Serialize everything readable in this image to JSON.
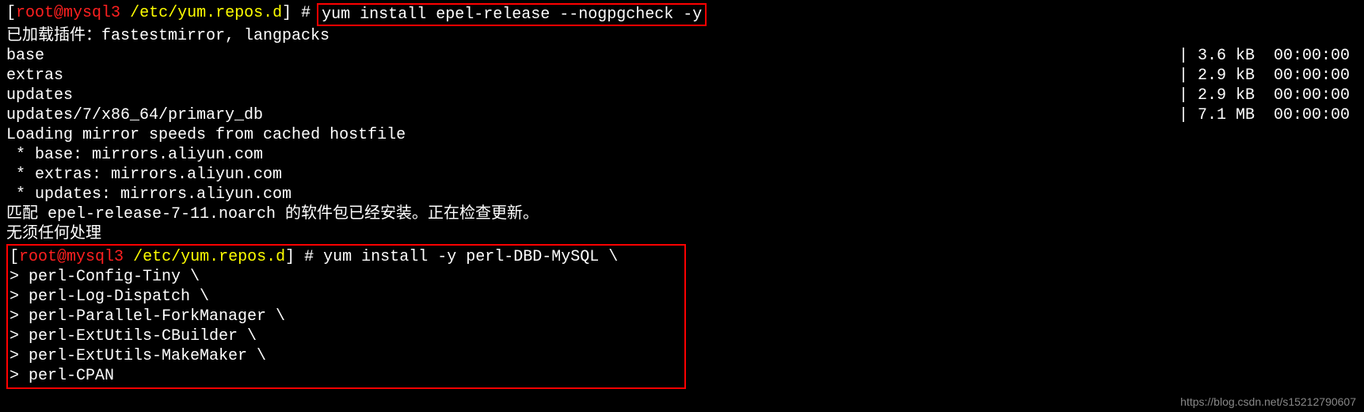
{
  "prompt1": {
    "user": "root",
    "at": "@",
    "host": "mysql3",
    "path": "/etc/yum.repos.d",
    "hash": "#",
    "command": "yum install epel-release --nogpgcheck -y"
  },
  "output": {
    "plugins": "已加载插件：fastestmirror, langpacks",
    "repos": [
      {
        "name": "base",
        "size": "3.6 kB",
        "time": "00:00:00"
      },
      {
        "name": "extras",
        "size": "2.9 kB",
        "time": "00:00:00"
      },
      {
        "name": "updates",
        "size": "2.9 kB",
        "time": "00:00:00"
      },
      {
        "name": "updates/7/x86_64/primary_db",
        "size": "7.1 MB",
        "time": "00:00:00"
      }
    ],
    "loading": "Loading mirror speeds from cached hostfile",
    "mirrors": [
      " * base: mirrors.aliyun.com",
      " * extras: mirrors.aliyun.com",
      " * updates: mirrors.aliyun.com"
    ],
    "match": "匹配 epel-release-7-11.noarch 的软件包已经安装。正在检查更新。",
    "nothing": "无须任何处理"
  },
  "prompt2": {
    "user": "root",
    "at": "@",
    "host": "mysql3",
    "path": "/etc/yum.repos.d",
    "hash": "#",
    "command": "yum install -y perl-DBD-MySQL \\",
    "continuations": [
      "> perl-Config-Tiny \\",
      "> perl-Log-Dispatch \\",
      "> perl-Parallel-ForkManager \\",
      "> perl-ExtUtils-CBuilder \\",
      "> perl-ExtUtils-MakeMaker \\",
      "> perl-CPAN"
    ]
  },
  "watermark": "https://blog.csdn.net/s15212790607"
}
